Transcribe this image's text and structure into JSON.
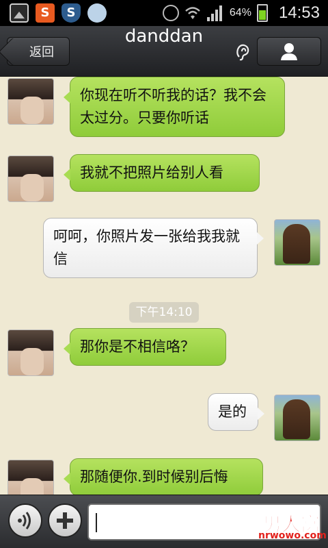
{
  "status_bar": {
    "battery_percent": "64%",
    "time": "14:53",
    "battery_level": 0.64,
    "icons": [
      "gallery-icon",
      "weibo-s-icon",
      "shield-icon",
      "qq-icon",
      "alarm-icon",
      "wifi-icon",
      "signal-icon",
      "battery-icon"
    ]
  },
  "header": {
    "back_label": "返回",
    "title": "danddan",
    "ear_icon": "earpiece-icon",
    "profile_icon": "person-icon"
  },
  "messages": [
    {
      "side": "left",
      "text": "你现在听不听我的话？我不会太过分。只要你听话"
    },
    {
      "side": "left",
      "text": "我就不把照片给别人看"
    },
    {
      "side": "right",
      "text": "呵呵，你照片发一张给我我就信"
    },
    {
      "side": "left",
      "text": "那你是不相信咯？"
    },
    {
      "side": "right",
      "text": "是的"
    },
    {
      "side": "left",
      "text": "那随便你.到时候别后悔"
    }
  ],
  "timestamp": "下午14:10",
  "input_bar": {
    "voice_icon": "voice-icon",
    "plus_icon": "plus-icon",
    "input_value": ""
  },
  "watermark": {
    "logo_text": "男人窝",
    "site_text": "nrwowo.com"
  },
  "colors": {
    "chat_bg": "#efe9d3",
    "green_bubble": "#9fd64a",
    "white_bubble": "#f6f6f6",
    "titlebar": "#2b2c2f"
  }
}
